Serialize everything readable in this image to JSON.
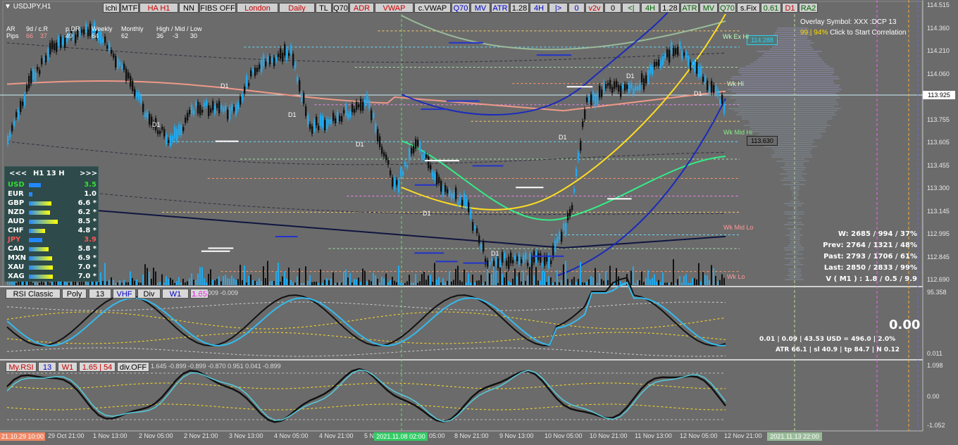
{
  "window": {
    "symbol": "USDJPY,H1"
  },
  "toolbar": [
    {
      "label": "ichi",
      "color": "#000000"
    },
    {
      "label": "MTF",
      "color": "#000000"
    },
    {
      "label": "HA H1",
      "color": "#cc0000"
    },
    {
      "label": "NN",
      "color": "#000000"
    },
    {
      "label": "FIBS OFF",
      "color": "#000000"
    },
    {
      "label": "London",
      "color": "#cc0000"
    },
    {
      "label": "Daily",
      "color": "#cc0000"
    },
    {
      "label": "TL",
      "color": "#000000"
    },
    {
      "label": "Q70",
      "color": "#000000"
    },
    {
      "label": "ADR",
      "color": "#cc0000"
    },
    {
      "label": "VWAP",
      "color": "#cc0000"
    },
    {
      "label": "c.VWAP",
      "color": "#000000"
    },
    {
      "label": "Q70",
      "color": "#0000cc"
    },
    {
      "label": "MV",
      "color": "#0000cc"
    },
    {
      "label": "ATR",
      "color": "#0000cc"
    },
    {
      "label": "1.28",
      "color": "#000000"
    },
    {
      "label": "4H",
      "color": "#0000cc"
    },
    {
      "label": "|>",
      "color": "#0000cc"
    },
    {
      "label": "0",
      "color": "#0000cc"
    },
    {
      "label": "v2v",
      "color": "#cc0000"
    },
    {
      "label": "0",
      "color": "#000000"
    },
    {
      "label": "<|",
      "color": "#006600"
    },
    {
      "label": "4H",
      "color": "#006600"
    },
    {
      "label": "1.28",
      "color": "#000000"
    },
    {
      "label": "ATR",
      "color": "#006600"
    },
    {
      "label": "MV",
      "color": "#006600"
    },
    {
      "label": "Q70",
      "color": "#006600"
    },
    {
      "label": "s.Fix",
      "color": "#000000"
    },
    {
      "label": "0.61",
      "color": "#006600"
    },
    {
      "label": "D1",
      "color": "#cc0000"
    },
    {
      "label": "RA2",
      "color": "#006600"
    }
  ],
  "pivot_header": {
    "labels": [
      "AR",
      "9d / c.R",
      "p.DR",
      "Weekly",
      "Monthly",
      "High / Mid / Low"
    ],
    "row_label": "Pips",
    "values": [
      "66",
      "37",
      "49",
      "64",
      "62",
      "36",
      "-3",
      "30"
    ]
  },
  "overlay": {
    "symbol_line": "Overlay Symbol: XXX :DCP 13",
    "correlation_values": "99 | 94%",
    "correlation_action": "Click to Start Correlation"
  },
  "strength_panel": {
    "nav_prev": "<<<",
    "timeframe": "H1  13  H",
    "nav_next": ">>>",
    "rows": [
      {
        "currency": "USD",
        "value": "3.5",
        "strength": 0.35,
        "color": "#33dd33",
        "bar": "#2288ff"
      },
      {
        "currency": "EUR",
        "value": "1.0",
        "strength": 0.1,
        "color": "#ffffff",
        "bar": "#2288ff"
      },
      {
        "currency": "GBP",
        "value": "6.6 *",
        "strength": 0.66,
        "color": "#ffffff",
        "bar": "#ffff00"
      },
      {
        "currency": "NZD",
        "value": "6.2 *",
        "strength": 0.62,
        "color": "#ffffff",
        "bar": "#ffff00"
      },
      {
        "currency": "AUD",
        "value": "8.5 *",
        "strength": 0.85,
        "color": "#ffffff",
        "bar": "#ffff00"
      },
      {
        "currency": "CHF",
        "value": "4.8 *",
        "strength": 0.48,
        "color": "#ffffff",
        "bar": "#ffff00"
      },
      {
        "currency": "JPY",
        "value": "3.9",
        "strength": 0.39,
        "color": "#ff5555",
        "bar": "#2288ff"
      },
      {
        "currency": "CAD",
        "value": "5.8 *",
        "strength": 0.58,
        "color": "#ffffff",
        "bar": "#ffff00"
      },
      {
        "currency": "MXN",
        "value": "6.9 *",
        "strength": 0.69,
        "color": "#ffffff",
        "bar": "#ffff00"
      },
      {
        "currency": "XAU",
        "value": "7.0 *",
        "strength": 0.7,
        "color": "#ffffff",
        "bar": "#ffff00"
      },
      {
        "currency": "XAG",
        "value": "7.0 *",
        "strength": 0.7,
        "color": "#ffffff",
        "bar": "#ffff00"
      }
    ]
  },
  "price_axis": [
    "114.515",
    "114.360",
    "114.210",
    "114.060",
    "113.905",
    "113.755",
    "113.605",
    "113.455",
    "113.300",
    "113.145",
    "112.995",
    "112.845",
    "112.690"
  ],
  "current_price": "113.925",
  "price_labels": [
    {
      "text": "114.288",
      "color": "#33ccee"
    },
    {
      "text": "113.630",
      "color": "#000000"
    }
  ],
  "level_labels": [
    {
      "text": "Wk Ex Hi",
      "color": "#bbffbb"
    },
    {
      "text": "Wk Hi",
      "color": "#ccffcc"
    },
    {
      "text": "Wk Mid Hi",
      "color": "#88ee88"
    },
    {
      "text": "Wk Mid Lo",
      "color": "#ff9999"
    },
    {
      "text": "Wk Lo",
      "color": "#ff9999"
    }
  ],
  "day_marker": "D1",
  "stats": {
    "rows": [
      {
        "label": "W:",
        "value": "2685 / 994 / 37%"
      },
      {
        "label": "Prev:",
        "value": "2764 / 1321 / 48%"
      },
      {
        "label": "Past:",
        "value": "2793 / 1706 / 61%"
      },
      {
        "label": "Last:",
        "value": "2850 / 2833 / 99%"
      },
      {
        "label": "V ( M1 ) :",
        "value": "1.8 / 0.5 / 9.9"
      }
    ]
  },
  "rsi_panel": {
    "buttons": [
      {
        "label": "RSI Classic",
        "color": "#000000"
      },
      {
        "label": "Poly",
        "color": "#000000"
      },
      {
        "label": "13",
        "color": "#000000"
      },
      {
        "label": "VHF",
        "color": "#0000cc"
      },
      {
        "label": "Div",
        "color": "#000000"
      },
      {
        "label": "W1",
        "color": "#0000cc"
      },
      {
        "label": "1.65",
        "color": "#ee00ee"
      }
    ],
    "params": "15,0.009 -0.009",
    "axis_top": "95.358",
    "axis_bottom": "0.011",
    "pnl": "0.00",
    "summary": "0.01  |  0.09  |  43.53 USD = 496.0  |  2.0%",
    "atr": "ATR 66.1  |  sl 40.9  |  tp 84.7  |  N 0.12"
  },
  "my_rsi_panel": {
    "buttons": [
      {
        "label": "My.RSI",
        "color": "#cc0000"
      },
      {
        "label": "13",
        "color": "#0000cc"
      },
      {
        "label": "W1",
        "color": "#cc0000"
      },
      {
        "label": "1.65 | 54",
        "color": "#cc0000"
      },
      {
        "label": "div.OFF",
        "color": "#000000"
      }
    ],
    "params": "1.645  -0.899 -0.899 -0.870 0.951 0.041 -0.899",
    "axis_top": "1.098",
    "axis_mid": "0.00",
    "axis_bottom": "-1.052"
  },
  "time_axis": {
    "start_label": "21.10.29 10:00",
    "labels": [
      "29 Oct 21:00",
      "1 Nov 13:00",
      "2 Nov 05:00",
      "2 Nov 21:00",
      "3 Nov 13:00",
      "4 Nov 05:00",
      "4 Nov 21:00",
      "5 N",
      "05:00",
      "8 Nov 21:00",
      "9 Nov 13:00",
      "10 Nov 05:00",
      "10 Nov 21:00",
      "11 Nov 13:00",
      "12 Nov 05:00",
      "12 Nov 21:00"
    ],
    "highlight_label": "2021.11.08 02:00",
    "end_label": "2021.11.13 22:00"
  }
}
